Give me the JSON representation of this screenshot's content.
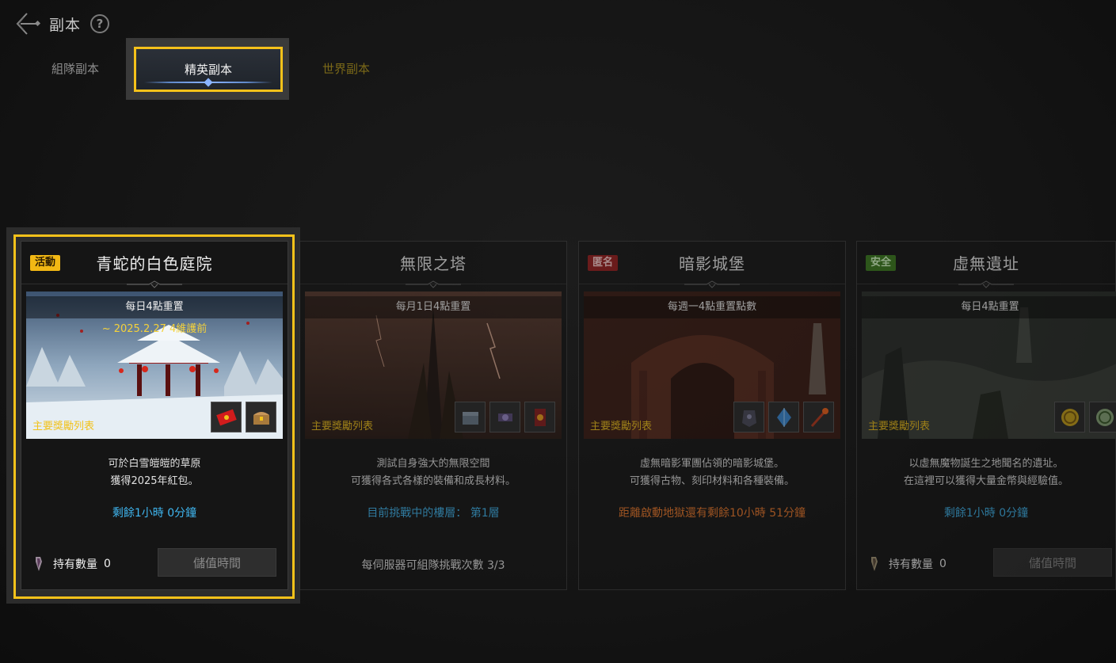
{
  "header": {
    "title": "副本",
    "help": "?"
  },
  "tabs": {
    "party": "組隊副本",
    "elite": "精英副本",
    "world": "世界副本"
  },
  "reward_label": "主要獎勵列表",
  "cards": [
    {
      "badge": "活動",
      "title": "青蛇的白色庭院",
      "reset": "每日4點重置",
      "sub": "~ 2025.2.27 4維護前",
      "desc1": "可於白雪皚皚的草原",
      "desc2": "獲得2025年紅包。",
      "timer": "剩餘1小時 0分鐘",
      "owned_label": "持有數量",
      "owned_value": "0",
      "button": "儲值時間",
      "rewards": [
        "red-envelope-icon",
        "treasure-chest-icon"
      ]
    },
    {
      "title": "無限之塔",
      "reset": "每月1日4點重置",
      "desc1": "測試自身強大的無限空間",
      "desc2": "可獲得各式各樣的裝備和成長材料。",
      "timer": "目前挑戰中的樓層： 第1層",
      "server_count": "每伺服器可組隊挑戰次數 3/3",
      "rewards": [
        "chest-icon",
        "scroll-icon",
        "card-icon"
      ]
    },
    {
      "badge": "匿名",
      "title": "暗影城堡",
      "reset": "每週一4點重置點數",
      "desc1": "虛無暗影軍團佔領的暗影城堡。",
      "desc2": "可獲得古物、刻印材料和各種裝備。",
      "timer": "距離啟動地獄還有剩餘10小時 51分鐘",
      "rewards": [
        "armor-icon",
        "crystal-icon",
        "staff-icon"
      ]
    },
    {
      "badge": "安全",
      "title": "虛無遺址",
      "reset": "每日4點重置",
      "desc1": "以虛無魔物誕生之地聞名的遺址。",
      "desc2": "在這裡可以獲得大量金幣與經驗值。",
      "timer": "剩餘1小時 0分鐘",
      "owned_label": "持有數量",
      "owned_value": "0",
      "button": "儲值時間",
      "rewards": [
        "gold-coin-icon",
        "exp-coin-icon"
      ]
    }
  ]
}
